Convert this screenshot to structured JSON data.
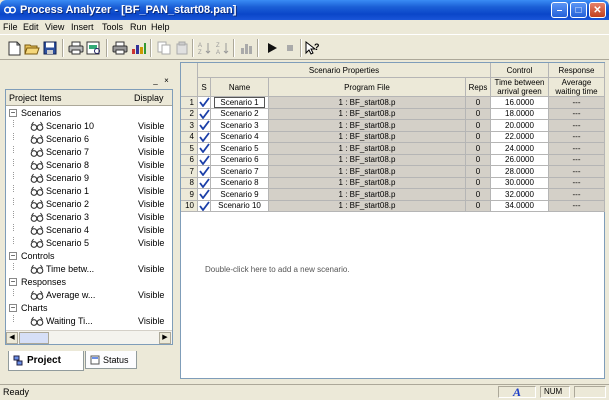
{
  "window": {
    "title": "Process Analyzer - [BF_PAN_start08.pan]",
    "buttons": {
      "minimize": "–",
      "maximize": "□",
      "close": "✕"
    }
  },
  "menu": [
    "File",
    "Edit",
    "View",
    "Insert",
    "Tools",
    "Run",
    "Help"
  ],
  "toolbar": {
    "icons": [
      "new-document",
      "open-folder",
      "save-disk",
      "print",
      "print-preview",
      "print-alt",
      "report",
      "cut",
      "copy",
      "sort-ascending",
      "sort-descending",
      "chart",
      "run-play",
      "stop",
      "help-pointer"
    ]
  },
  "left_panel": {
    "columns": {
      "items": "Project Items",
      "display": "Display"
    },
    "tree": [
      {
        "label": "Scenarios",
        "level": 0,
        "toggle": "−"
      },
      {
        "label": "Scenario 10",
        "display": "Visible",
        "level": 1
      },
      {
        "label": "Scenario 6",
        "display": "Visible",
        "level": 1
      },
      {
        "label": "Scenario 7",
        "display": "Visible",
        "level": 1
      },
      {
        "label": "Scenario 8",
        "display": "Visible",
        "level": 1
      },
      {
        "label": "Scenario 9",
        "display": "Visible",
        "level": 1
      },
      {
        "label": "Scenario 1",
        "display": "Visible",
        "level": 1
      },
      {
        "label": "Scenario 2",
        "display": "Visible",
        "level": 1
      },
      {
        "label": "Scenario 3",
        "display": "Visible",
        "level": 1
      },
      {
        "label": "Scenario 4",
        "display": "Visible",
        "level": 1
      },
      {
        "label": "Scenario 5",
        "display": "Visible",
        "level": 1
      },
      {
        "label": "Controls",
        "level": 0,
        "toggle": "−"
      },
      {
        "label": "Time betw...",
        "display": "Visible",
        "level": 1
      },
      {
        "label": "Responses",
        "level": 0,
        "toggle": "−"
      },
      {
        "label": "Average w...",
        "display": "Visible",
        "level": 1
      },
      {
        "label": "Charts",
        "level": 0,
        "toggle": "−"
      },
      {
        "label": "Waiting Ti...",
        "display": "Visible",
        "level": 1
      }
    ],
    "tabs": [
      {
        "label": "Project",
        "active": true
      },
      {
        "label": "Status",
        "active": false
      }
    ]
  },
  "grid": {
    "group_headers": {
      "scenario_properties": "Scenario Properties",
      "control": "Control",
      "response": "Response"
    },
    "columns": {
      "s": "S",
      "name": "Name",
      "program_file": "Program File",
      "reps": "Reps",
      "time_between": "Time between arrival green",
      "average_waiting": "Average waiting time"
    },
    "rows": [
      {
        "num": "1",
        "name": "Scenario 1",
        "file": "1 : BF_start08.p",
        "reps": "0",
        "time": "16.0000",
        "avg": "---"
      },
      {
        "num": "2",
        "name": "Scenario 2",
        "file": "1 : BF_start08.p",
        "reps": "0",
        "time": "18.0000",
        "avg": "---"
      },
      {
        "num": "3",
        "name": "Scenario 3",
        "file": "1 : BF_start08.p",
        "reps": "0",
        "time": "20.0000",
        "avg": "---"
      },
      {
        "num": "4",
        "name": "Scenario 4",
        "file": "1 : BF_start08.p",
        "reps": "0",
        "time": "22.0000",
        "avg": "---"
      },
      {
        "num": "5",
        "name": "Scenario 5",
        "file": "1 : BF_start08.p",
        "reps": "0",
        "time": "24.0000",
        "avg": "---"
      },
      {
        "num": "6",
        "name": "Scenario 6",
        "file": "1 : BF_start08.p",
        "reps": "0",
        "time": "26.0000",
        "avg": "---"
      },
      {
        "num": "7",
        "name": "Scenario 7",
        "file": "1 : BF_start08.p",
        "reps": "0",
        "time": "28.0000",
        "avg": "---"
      },
      {
        "num": "8",
        "name": "Scenario 8",
        "file": "1 : BF_start08.p",
        "reps": "0",
        "time": "30.0000",
        "avg": "---"
      },
      {
        "num": "9",
        "name": "Scenario 9",
        "file": "1 : BF_start08.p",
        "reps": "0",
        "time": "32.0000",
        "avg": "---"
      },
      {
        "num": "10",
        "name": "Scenario 10",
        "file": "1 : BF_start08.p",
        "reps": "0",
        "time": "34.0000",
        "avg": "---"
      }
    ],
    "add_hint": "Double-click here to add a new scenario."
  },
  "status_bar": {
    "text": "Ready",
    "indicator": "A",
    "num": "NUM"
  }
}
